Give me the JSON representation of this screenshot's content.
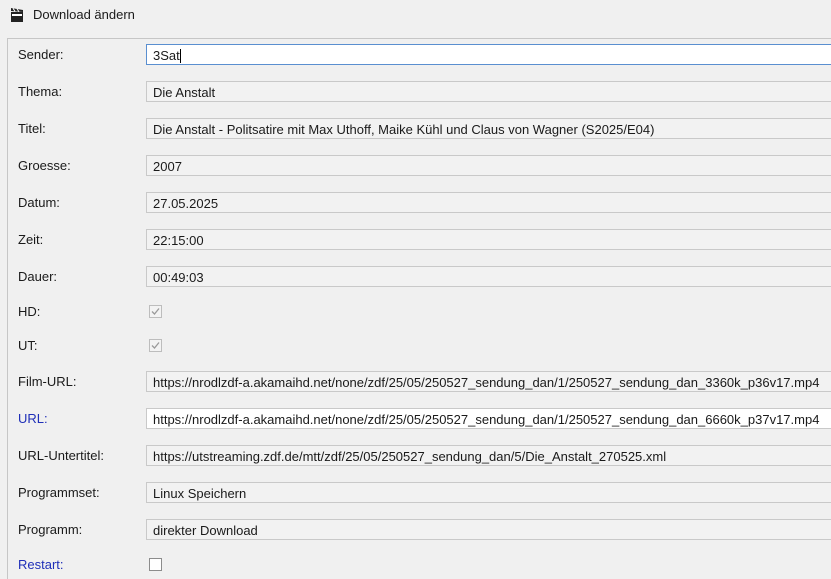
{
  "window": {
    "title": "Download ändern",
    "icon": "clapperboard-icon"
  },
  "fields": [
    {
      "label": "Sender:",
      "value": "3Sat"
    },
    {
      "label": "Thema:",
      "value": "Die Anstalt"
    },
    {
      "label": "Titel:",
      "value": "Die Anstalt - Politsatire mit Max Uthoff, Maike Kühl und Claus von Wagner (S2025/E04)"
    },
    {
      "label": "Groesse:",
      "value": "2007"
    },
    {
      "label": "Datum:",
      "value": "27.05.2025"
    },
    {
      "label": "Zeit:",
      "value": "22:15:00"
    },
    {
      "label": "Dauer:",
      "value": "00:49:03"
    },
    {
      "label": "HD:",
      "checked": true
    },
    {
      "label": "UT:",
      "checked": true
    },
    {
      "label": "Film-URL:",
      "value": "https://nrodlzdf-a.akamaihd.net/none/zdf/25/05/250527_sendung_dan/1/250527_sendung_dan_3360k_p36v17.mp4"
    },
    {
      "label": "URL:",
      "value": "https://nrodlzdf-a.akamaihd.net/none/zdf/25/05/250527_sendung_dan/1/250527_sendung_dan_6660k_p37v17.mp4"
    },
    {
      "label": "URL-Untertitel:",
      "value": "https://utstreaming.zdf.de/mtt/zdf/25/05/250527_sendung_dan/5/Die_Anstalt_270525.xml"
    },
    {
      "label": "Programmset:",
      "value": "Linux Speichern"
    },
    {
      "label": "Programm:",
      "value": "direkter Download"
    },
    {
      "label": "Restart:",
      "checked": false
    }
  ],
  "colors": {
    "link_label": "#1f2fb8",
    "focus_border": "#5a8fd0"
  }
}
